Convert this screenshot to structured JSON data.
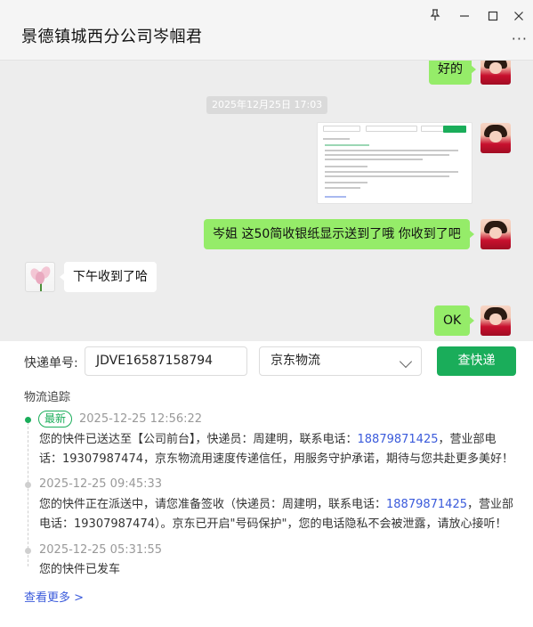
{
  "window": {
    "title": "景德镇城西分公司岑帼君",
    "controls": {
      "pin": "⊥",
      "minimize": "—",
      "maximize": "☐",
      "close": "✕"
    },
    "more": "···"
  },
  "chat": {
    "messages": [
      {
        "from": "me",
        "text": "好的"
      },
      {
        "type": "time",
        "text": "2025年12月25日 17:03"
      },
      {
        "from": "me",
        "type": "image"
      },
      {
        "from": "me",
        "text": "岑姐 这50简收银纸显示送到了哦  你收到了吧"
      },
      {
        "from": "other",
        "text": "下午收到了哈"
      },
      {
        "from": "me",
        "text": "OK"
      }
    ]
  },
  "query": {
    "label": "快递单号:",
    "tracking_number": "JDVE16587158794",
    "carrier": "京东物流",
    "button": "查快递"
  },
  "tracking": {
    "section_title": "物流追踪",
    "events": [
      {
        "badge": "最新",
        "time": "2025-12-25 12:56:22",
        "line1a": "您的快件已送达至【公司前台】，快递员：周建明，联系电话：",
        "line1phone": "18879871425",
        "line1b": "，营业部电",
        "line2": "话：19307987474，京东物流用速度传递信任，用服务守护承诺，期待与您共赴更多美好！"
      },
      {
        "time": "2025-12-25 09:45:33",
        "line1a": "您的快件正在派送中，请您准备签收（快递员：周建明，联系电话：",
        "line1phone": "18879871425",
        "line1b": "，营业部",
        "line2": "电话：19307987474）。京东已开启\"号码保护\"，您的电话隐私不会被泄露，请放心接听！"
      },
      {
        "time": "2025-12-25 05:31:55",
        "line1a": "您的快件已发车"
      }
    ],
    "more": "查看更多 >"
  },
  "colors": {
    "accent": "#1aad5a",
    "bubble_me": "#95ec69",
    "link": "#3b5bdb"
  }
}
